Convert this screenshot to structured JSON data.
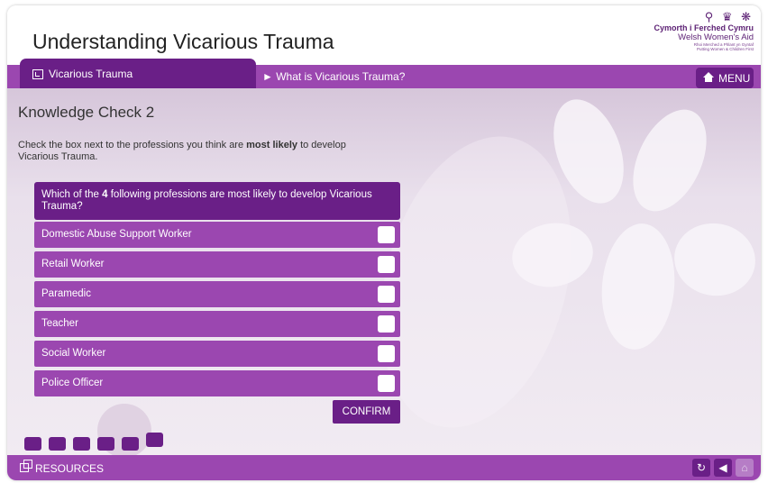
{
  "header": {
    "course_title": "Understanding Vicarious Trauma",
    "logo": {
      "icon_names": [
        "pin-icon",
        "figure-icon",
        "flower-icon"
      ],
      "line1": "Cymorth i Ferched Cymru",
      "line2": "Welsh Women's Aid",
      "line3": "Rhoi Merched a Phlant yn Gyntaf",
      "line4": "Putting Women & Children First"
    }
  },
  "nav": {
    "section_label": "Vicarious Trauma",
    "breadcrumb": "► What is Vicarious Trauma?",
    "menu_label": "MENU"
  },
  "page": {
    "title": "Knowledge Check 2",
    "instructions_pre": "Check the box next to the professions you think are ",
    "instructions_bold": "most likely",
    "instructions_post": " to develop Vicarious Trauma.",
    "question_pre": "Which of the ",
    "question_bold": "4",
    "question_post": " following professions are most likely to develop Vicarious Trauma?",
    "options": [
      {
        "label": "Domestic Abuse Support Worker",
        "checked": false
      },
      {
        "label": "Retail Worker",
        "checked": false
      },
      {
        "label": "Paramedic",
        "checked": false
      },
      {
        "label": "Teacher",
        "checked": false
      },
      {
        "label": "Social Worker",
        "checked": false
      },
      {
        "label": "Police Officer",
        "checked": false
      }
    ],
    "confirm_label": "CONFIRM"
  },
  "progress": {
    "total": 6,
    "current": 6
  },
  "footer": {
    "resources_label": "RESOURCES",
    "icon_names": [
      "refresh-icon",
      "back-icon",
      "home-icon"
    ]
  },
  "colors": {
    "dark_purple": "#6a1f87",
    "purple": "#9b47b0"
  }
}
